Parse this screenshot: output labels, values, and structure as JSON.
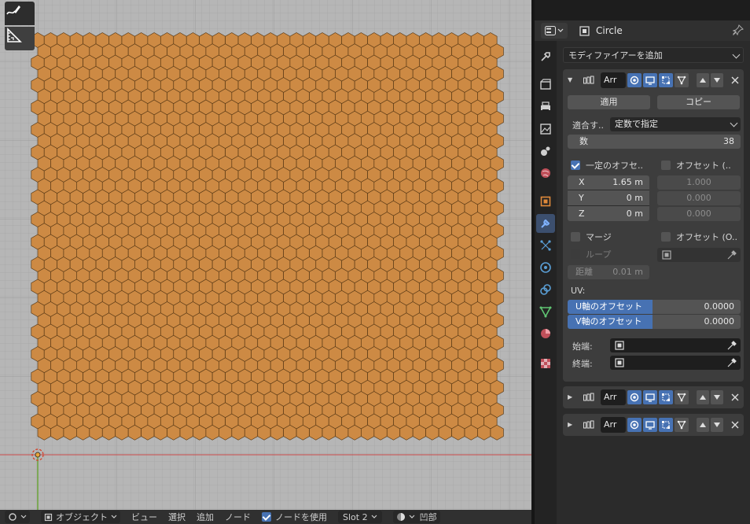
{
  "colors": {
    "hex_fill": "#cd8a44",
    "hex_stroke": "#5a3a16",
    "accent": "#4772b3",
    "x_axis": "#c94a4a",
    "y_axis": "#6aa338"
  },
  "header": {
    "object_name": "Circle"
  },
  "panel": {
    "add_modifier": "モディファイアーを追加",
    "modifier": {
      "name": "Arr",
      "apply": "適用",
      "copy": "コピー",
      "fit_type_label": "適合す..",
      "fit_type_value": "定数で指定",
      "count_label": "数",
      "count_value": "38",
      "const_offset_label": "一定のオフセ..",
      "rel_offset_label": "オフセット (..",
      "x_label": "X",
      "x_value": "1.65 m",
      "y_label": "Y",
      "y_value": "0 m",
      "z_label": "Z",
      "z_value": "0 m",
      "rel_x": "1.000",
      "rel_y": "0.000",
      "rel_z": "0.000",
      "merge_label": "マージ",
      "obj_offset_label": "オフセット (O..",
      "loop_label": "ループ",
      "distance_label": "距離",
      "distance_value": "0.01 m",
      "uv_label": "UV:",
      "u_offset_label": "U軸のオフセット",
      "u_offset_value": "0.0000",
      "v_offset_label": "V軸のオフセット",
      "v_offset_value": "0.0000",
      "start_cap_label": "始端:",
      "end_cap_label": "終端:"
    },
    "collapsed_modifiers": [
      {
        "name": "Arr"
      },
      {
        "name": "Arr"
      }
    ]
  },
  "bottom_header": {
    "mode": "オブジェクト",
    "view": "ビュー",
    "select": "選択",
    "add": "追加",
    "node": "ノード",
    "use_nodes": "ノードを使用",
    "slot": "Slot 2",
    "material": "凹部"
  }
}
